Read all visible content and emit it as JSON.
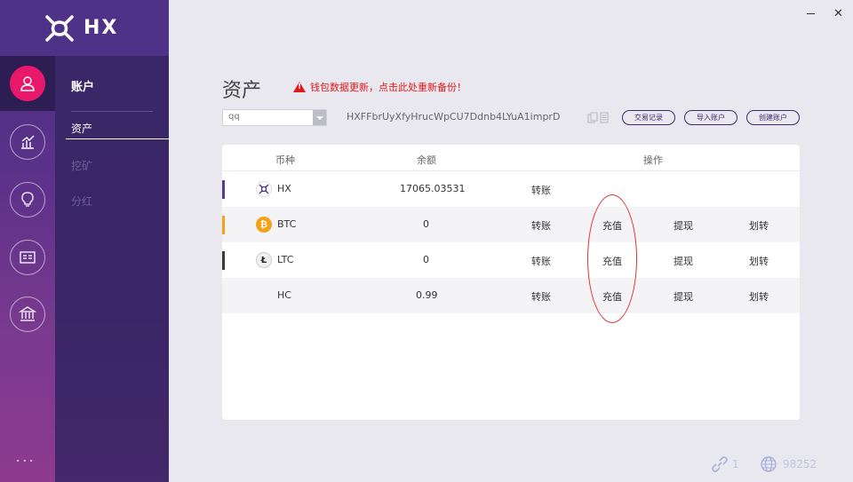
{
  "app": {
    "logo_text": "HX"
  },
  "rail": {
    "items": [
      "account-icon",
      "chart-icon",
      "bulb-icon",
      "card-icon",
      "bank-icon"
    ],
    "more": "..."
  },
  "subnav": {
    "title": "账户",
    "items": [
      {
        "label": "资产",
        "active": true
      },
      {
        "label": "挖矿",
        "active": false
      },
      {
        "label": "分红",
        "active": false
      }
    ]
  },
  "header": {
    "title": "资产",
    "warning": "钱包数据更新，点击此处重新备份！"
  },
  "account": {
    "selected": "qq",
    "address": "HXFFbrUyXfyHrucWpCU7Ddnb4LYuA1imprD"
  },
  "actions": {
    "tx_history": "交易记录",
    "import_account": "导入账户",
    "create_account": "创建账户"
  },
  "table": {
    "headers": {
      "coin": "币种",
      "balance": "余额",
      "ops": "操作"
    },
    "rows": [
      {
        "coin": "HX",
        "balance": "17065.03531",
        "transfer": "转账",
        "deposit": "",
        "withdraw": "",
        "move": "",
        "color": "#5a3c94"
      },
      {
        "coin": "BTC",
        "balance": "0",
        "transfer": "转账",
        "deposit": "充值",
        "withdraw": "提现",
        "move": "划转",
        "color": "#f4a21c"
      },
      {
        "coin": "LTC",
        "balance": "0",
        "transfer": "转账",
        "deposit": "充值",
        "withdraw": "提现",
        "move": "划转",
        "color": "#3a3a3a"
      },
      {
        "coin": "HC",
        "balance": "0.99",
        "transfer": "转账",
        "deposit": "充值",
        "withdraw": "提现",
        "move": "划转",
        "color": ""
      }
    ]
  },
  "status": {
    "peers": "1",
    "block_height": "98252"
  },
  "colors": {
    "accent": "#e8186b",
    "purple": "#3d2a70",
    "warning": "#e01818"
  }
}
